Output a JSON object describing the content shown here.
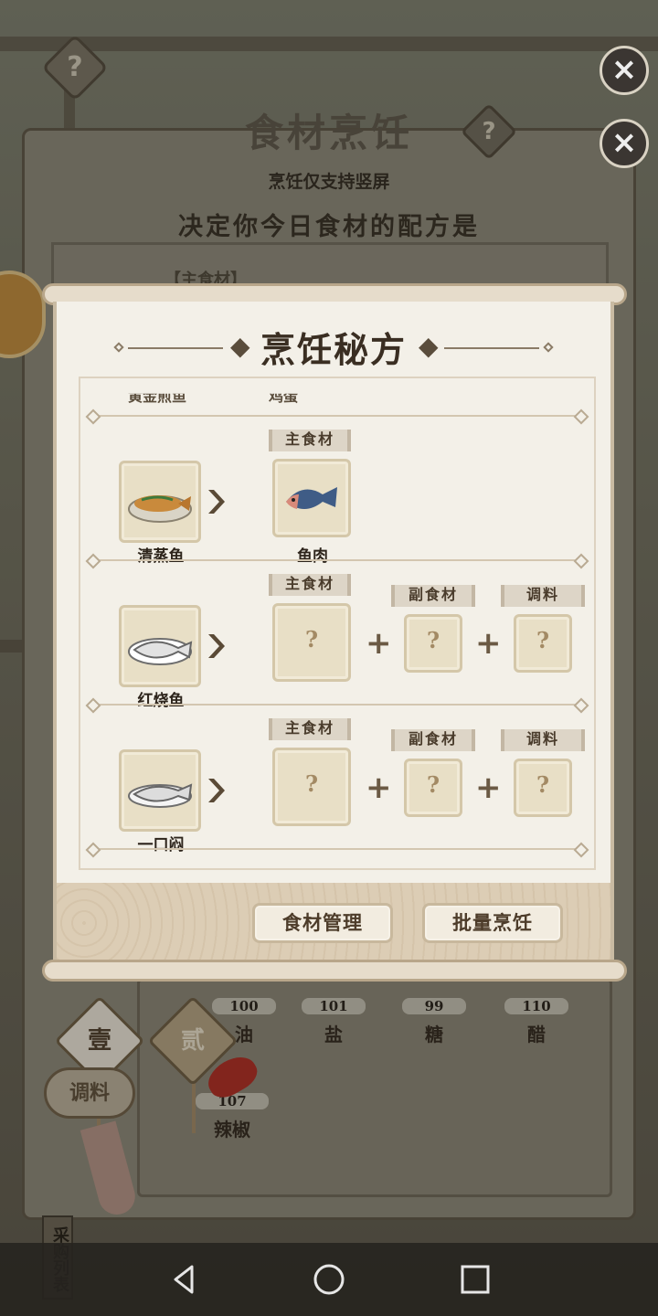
{
  "background": {
    "title": "食材烹饪",
    "subtitle": "烹饪仅支持竖屏",
    "question": "决定你今日食材的配方是",
    "frame_tag": "【主食材】",
    "items": [
      {
        "count": "100",
        "name": "油"
      },
      {
        "count": "101",
        "name": "盐"
      },
      {
        "count": "99",
        "name": "糖"
      },
      {
        "count": "110",
        "name": "醋"
      },
      {
        "count": "107",
        "name": "辣椒"
      }
    ],
    "tabs": [
      "壹",
      "贰"
    ],
    "tiao_label": "调料",
    "caiyou_label": "采购列表"
  },
  "modal": {
    "title": "烹饪秘方",
    "cut_labels": [
      "黄金煎鱼",
      "鸡蛋"
    ],
    "recipes": [
      {
        "dish": "清蒸鱼",
        "dish_icon": "steamed-fish-icon",
        "main_tag": "主食材",
        "main_name": "鱼肉",
        "main_icon": "fish-icon"
      },
      {
        "dish": "红烧鱼",
        "dish_icon": "braised-fish-silhouette-icon",
        "main_tag": "主食材",
        "main_value": "?",
        "side_tag": "副食材",
        "side_value": "?",
        "seasoning_tag": "调料",
        "seasoning_value": "?"
      },
      {
        "dish": "一口闷",
        "dish_icon": "fish-silhouette-icon",
        "main_tag": "主食材",
        "main_value": "?",
        "side_tag": "副食材",
        "side_value": "?",
        "seasoning_tag": "调料",
        "seasoning_value": "?"
      }
    ],
    "buttons": {
      "manage": "食材管理",
      "batch": "批量烹饪"
    }
  },
  "colors": {
    "modal_bg": "#f3f0e8",
    "card_bg": "#e8dfc6",
    "text_dark": "#3a2e22"
  }
}
